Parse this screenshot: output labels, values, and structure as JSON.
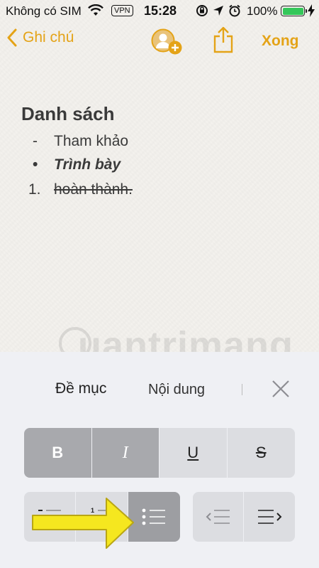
{
  "status_bar": {
    "carrier": "Không có SIM",
    "vpn": "VPN",
    "time": "15:28",
    "battery": "100%"
  },
  "nav": {
    "back_label": "Ghi chú",
    "done_label": "Xong"
  },
  "note": {
    "heading": "Danh sách",
    "items": [
      {
        "marker": "-",
        "text": "Tham khảo",
        "style": "plain"
      },
      {
        "marker": "•",
        "text": "Trình bày",
        "style": "bold-italic"
      },
      {
        "marker": "1.",
        "text": "hoàn thành.",
        "style": "strikethrough"
      }
    ]
  },
  "watermark": "uantrimang",
  "format_panel": {
    "tabs": [
      "Đề mục",
      "Nội dung"
    ],
    "styles": [
      "B",
      "I",
      "U",
      "S"
    ],
    "list_buttons": [
      "dashed-list-icon",
      "numbered-list-icon",
      "bulleted-list-icon"
    ],
    "selected_list": "bulleted-list-icon",
    "indent_buttons": [
      "outdent-icon",
      "indent-icon"
    ]
  },
  "colors": {
    "accent": "#e4a317",
    "panel_bg": "#eff0f4",
    "selected_cell": "#a8a9ad",
    "arrow": "#f5e71f"
  }
}
